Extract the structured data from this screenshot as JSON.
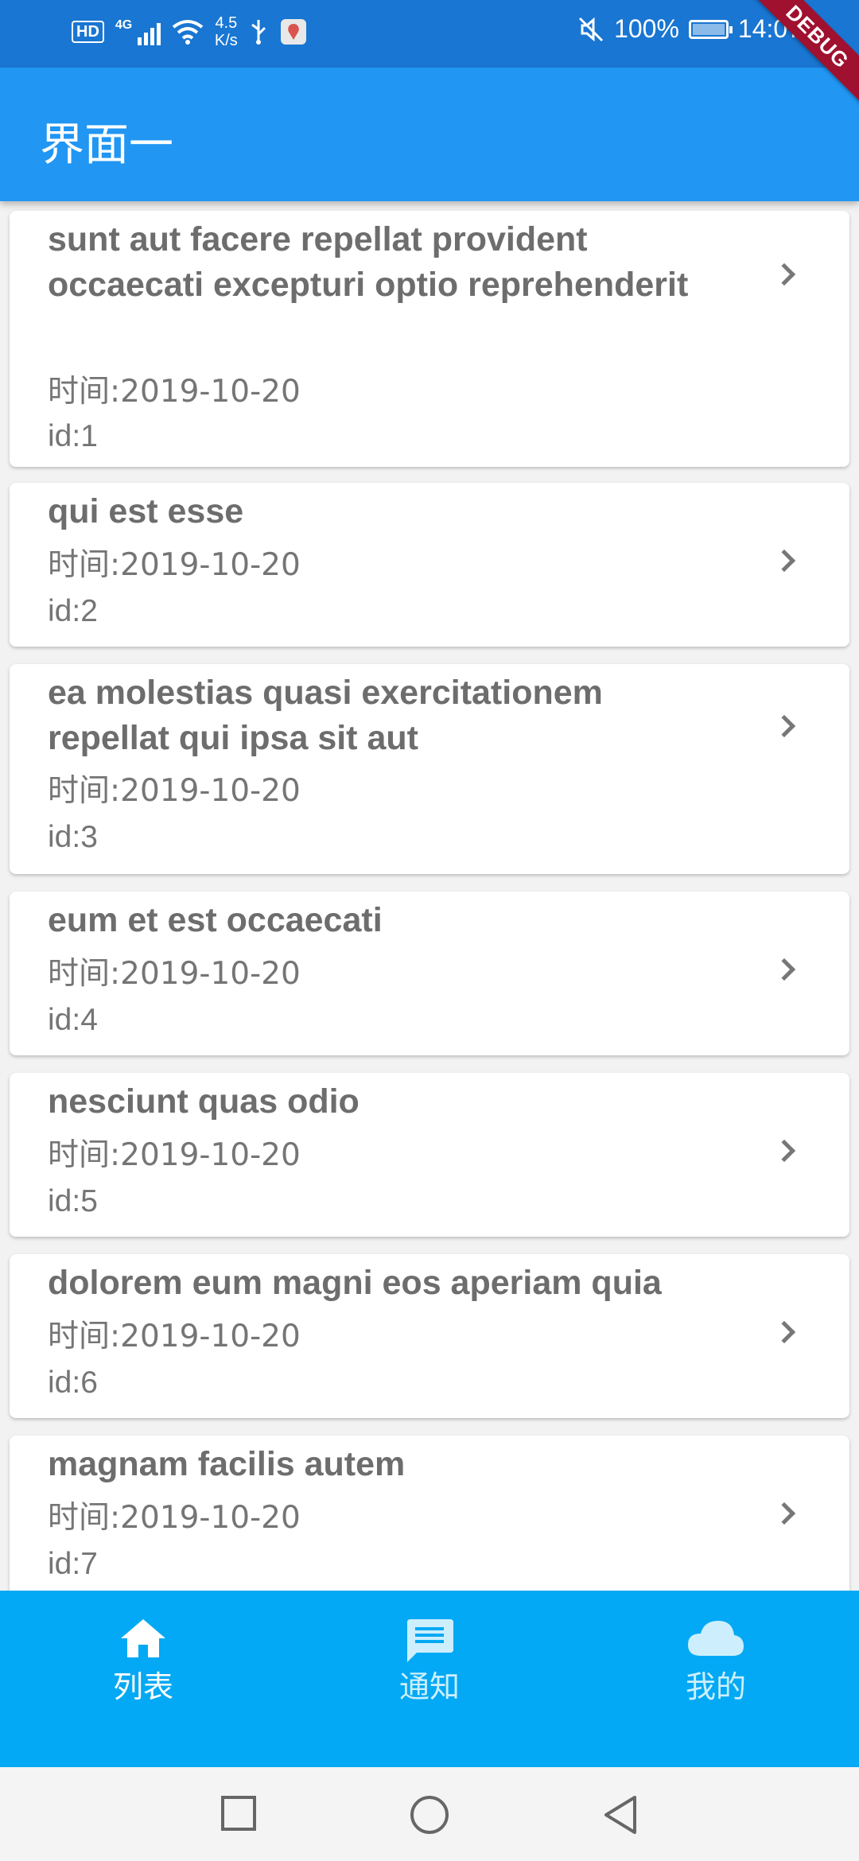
{
  "status_bar": {
    "hd": "HD",
    "network": "4G",
    "speed_value": "4.5",
    "speed_unit": "K/s",
    "battery": "100%",
    "time": "14:07"
  },
  "debug_banner": "DEBUG",
  "app_bar": {
    "title": "界面一"
  },
  "list": [
    {
      "title": "sunt aut facere repellat provident occaecati excepturi optio reprehenderit",
      "time": "时间:2019-10-20",
      "id": "id:1"
    },
    {
      "title": "qui est esse",
      "time": "时间:2019-10-20",
      "id": "id:2"
    },
    {
      "title": "ea molestias quasi exercitationem repellat qui ipsa sit aut",
      "time": "时间:2019-10-20",
      "id": "id:3"
    },
    {
      "title": "eum et est occaecati",
      "time": "时间:2019-10-20",
      "id": "id:4"
    },
    {
      "title": "nesciunt quas odio",
      "time": "时间:2019-10-20",
      "id": "id:5"
    },
    {
      "title": "dolorem eum magni eos aperiam quia",
      "time": "时间:2019-10-20",
      "id": "id:6"
    },
    {
      "title": "magnam facilis autem",
      "time": "时间:2019-10-20",
      "id": "id:7"
    }
  ],
  "bottom_nav": [
    {
      "label": "列表",
      "icon": "home-icon",
      "active": true
    },
    {
      "label": "通知",
      "icon": "message-icon",
      "active": false
    },
    {
      "label": "我的",
      "icon": "cloud-icon",
      "active": false
    }
  ],
  "system_nav": {
    "icons": [
      "recents-icon",
      "home-circle-icon",
      "back-icon"
    ]
  },
  "colors": {
    "status_bar": "#1976d2",
    "app_bar": "#2196f3",
    "bottom_nav": "#03a9f4",
    "debug": "#a0102f",
    "text_grey": "#6d6d6d"
  }
}
